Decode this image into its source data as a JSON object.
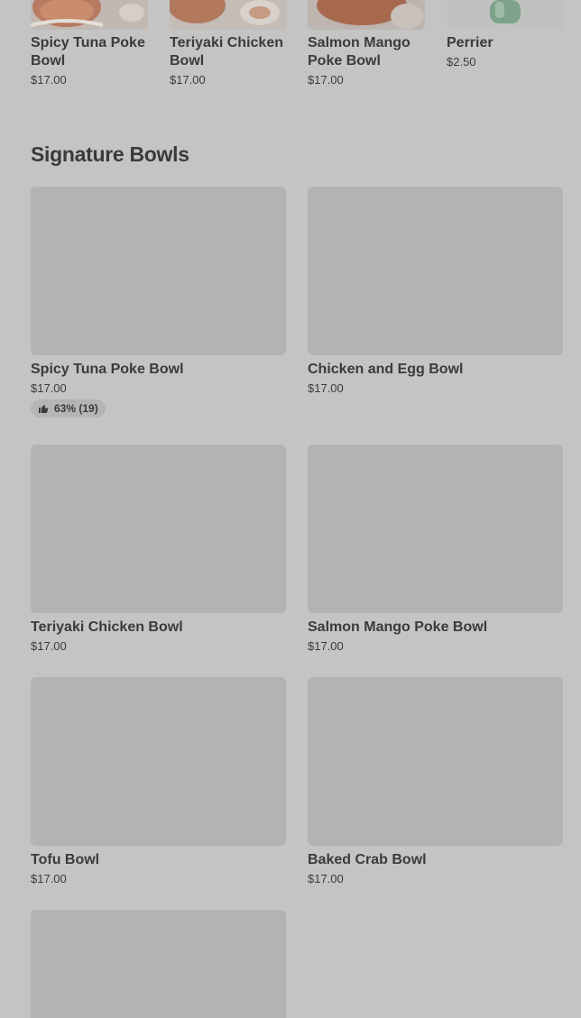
{
  "top_items": [
    {
      "name": "Spicy Tuna Poke Bowl",
      "price": "$17.00"
    },
    {
      "name": "Teriyaki Chicken Bowl",
      "price": "$17.00"
    },
    {
      "name": "Salmon Mango Poke Bowl",
      "price": "$17.00"
    },
    {
      "name": "Perrier",
      "price": "$2.50"
    }
  ],
  "section": {
    "title": "Signature Bowls"
  },
  "bowls": [
    {
      "name": "Spicy Tuna Poke Bowl",
      "price": "$17.00",
      "rating": "63% (19)"
    },
    {
      "name": "Chicken and Egg Bowl",
      "price": "$17.00"
    },
    {
      "name": "Teriyaki Chicken Bowl",
      "price": "$17.00"
    },
    {
      "name": "Salmon Mango Poke Bowl",
      "price": "$17.00"
    },
    {
      "name": "Tofu Bowl",
      "price": "$17.00"
    },
    {
      "name": "Baked Crab Bowl",
      "price": "$17.00"
    }
  ],
  "icons": {
    "rating": "thumbs-up-icon"
  }
}
